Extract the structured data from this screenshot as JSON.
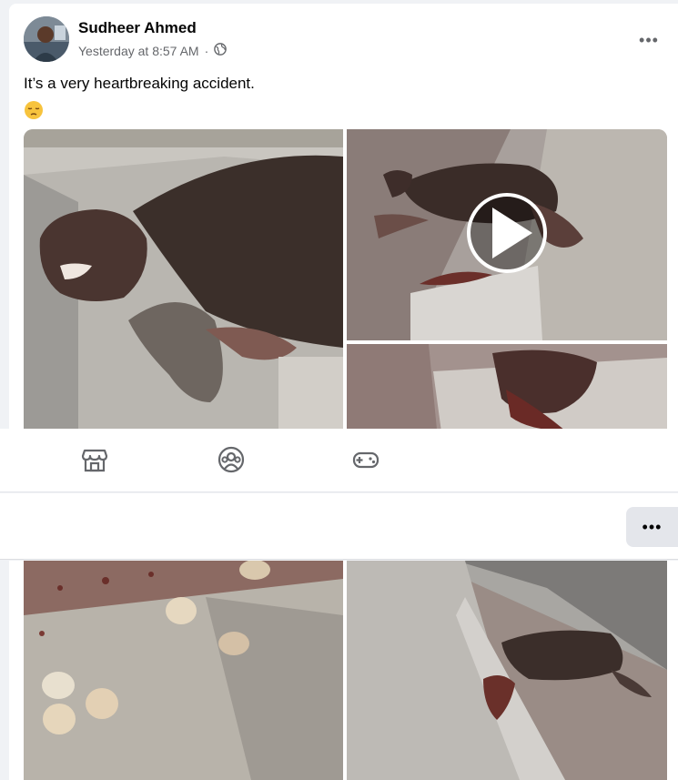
{
  "post": {
    "author": "Sudheer Ahmed",
    "timestamp": "Yesterday at 8:57 AM",
    "separator": "·",
    "privacy_icon": "globe-icon",
    "more_label": "•••",
    "text": "It’s a very heartbreaking accident.",
    "emoji_icon": "pensive-face-icon"
  },
  "nav": {
    "icons": [
      "marketplace-icon",
      "groups-icon",
      "gaming-icon"
    ]
  },
  "menu": {
    "more_label": "•••"
  },
  "colors": {
    "primary_text": "#050505",
    "secondary_text": "#65676b",
    "background": "#f0f2f5",
    "button_gray": "#e4e6eb"
  }
}
